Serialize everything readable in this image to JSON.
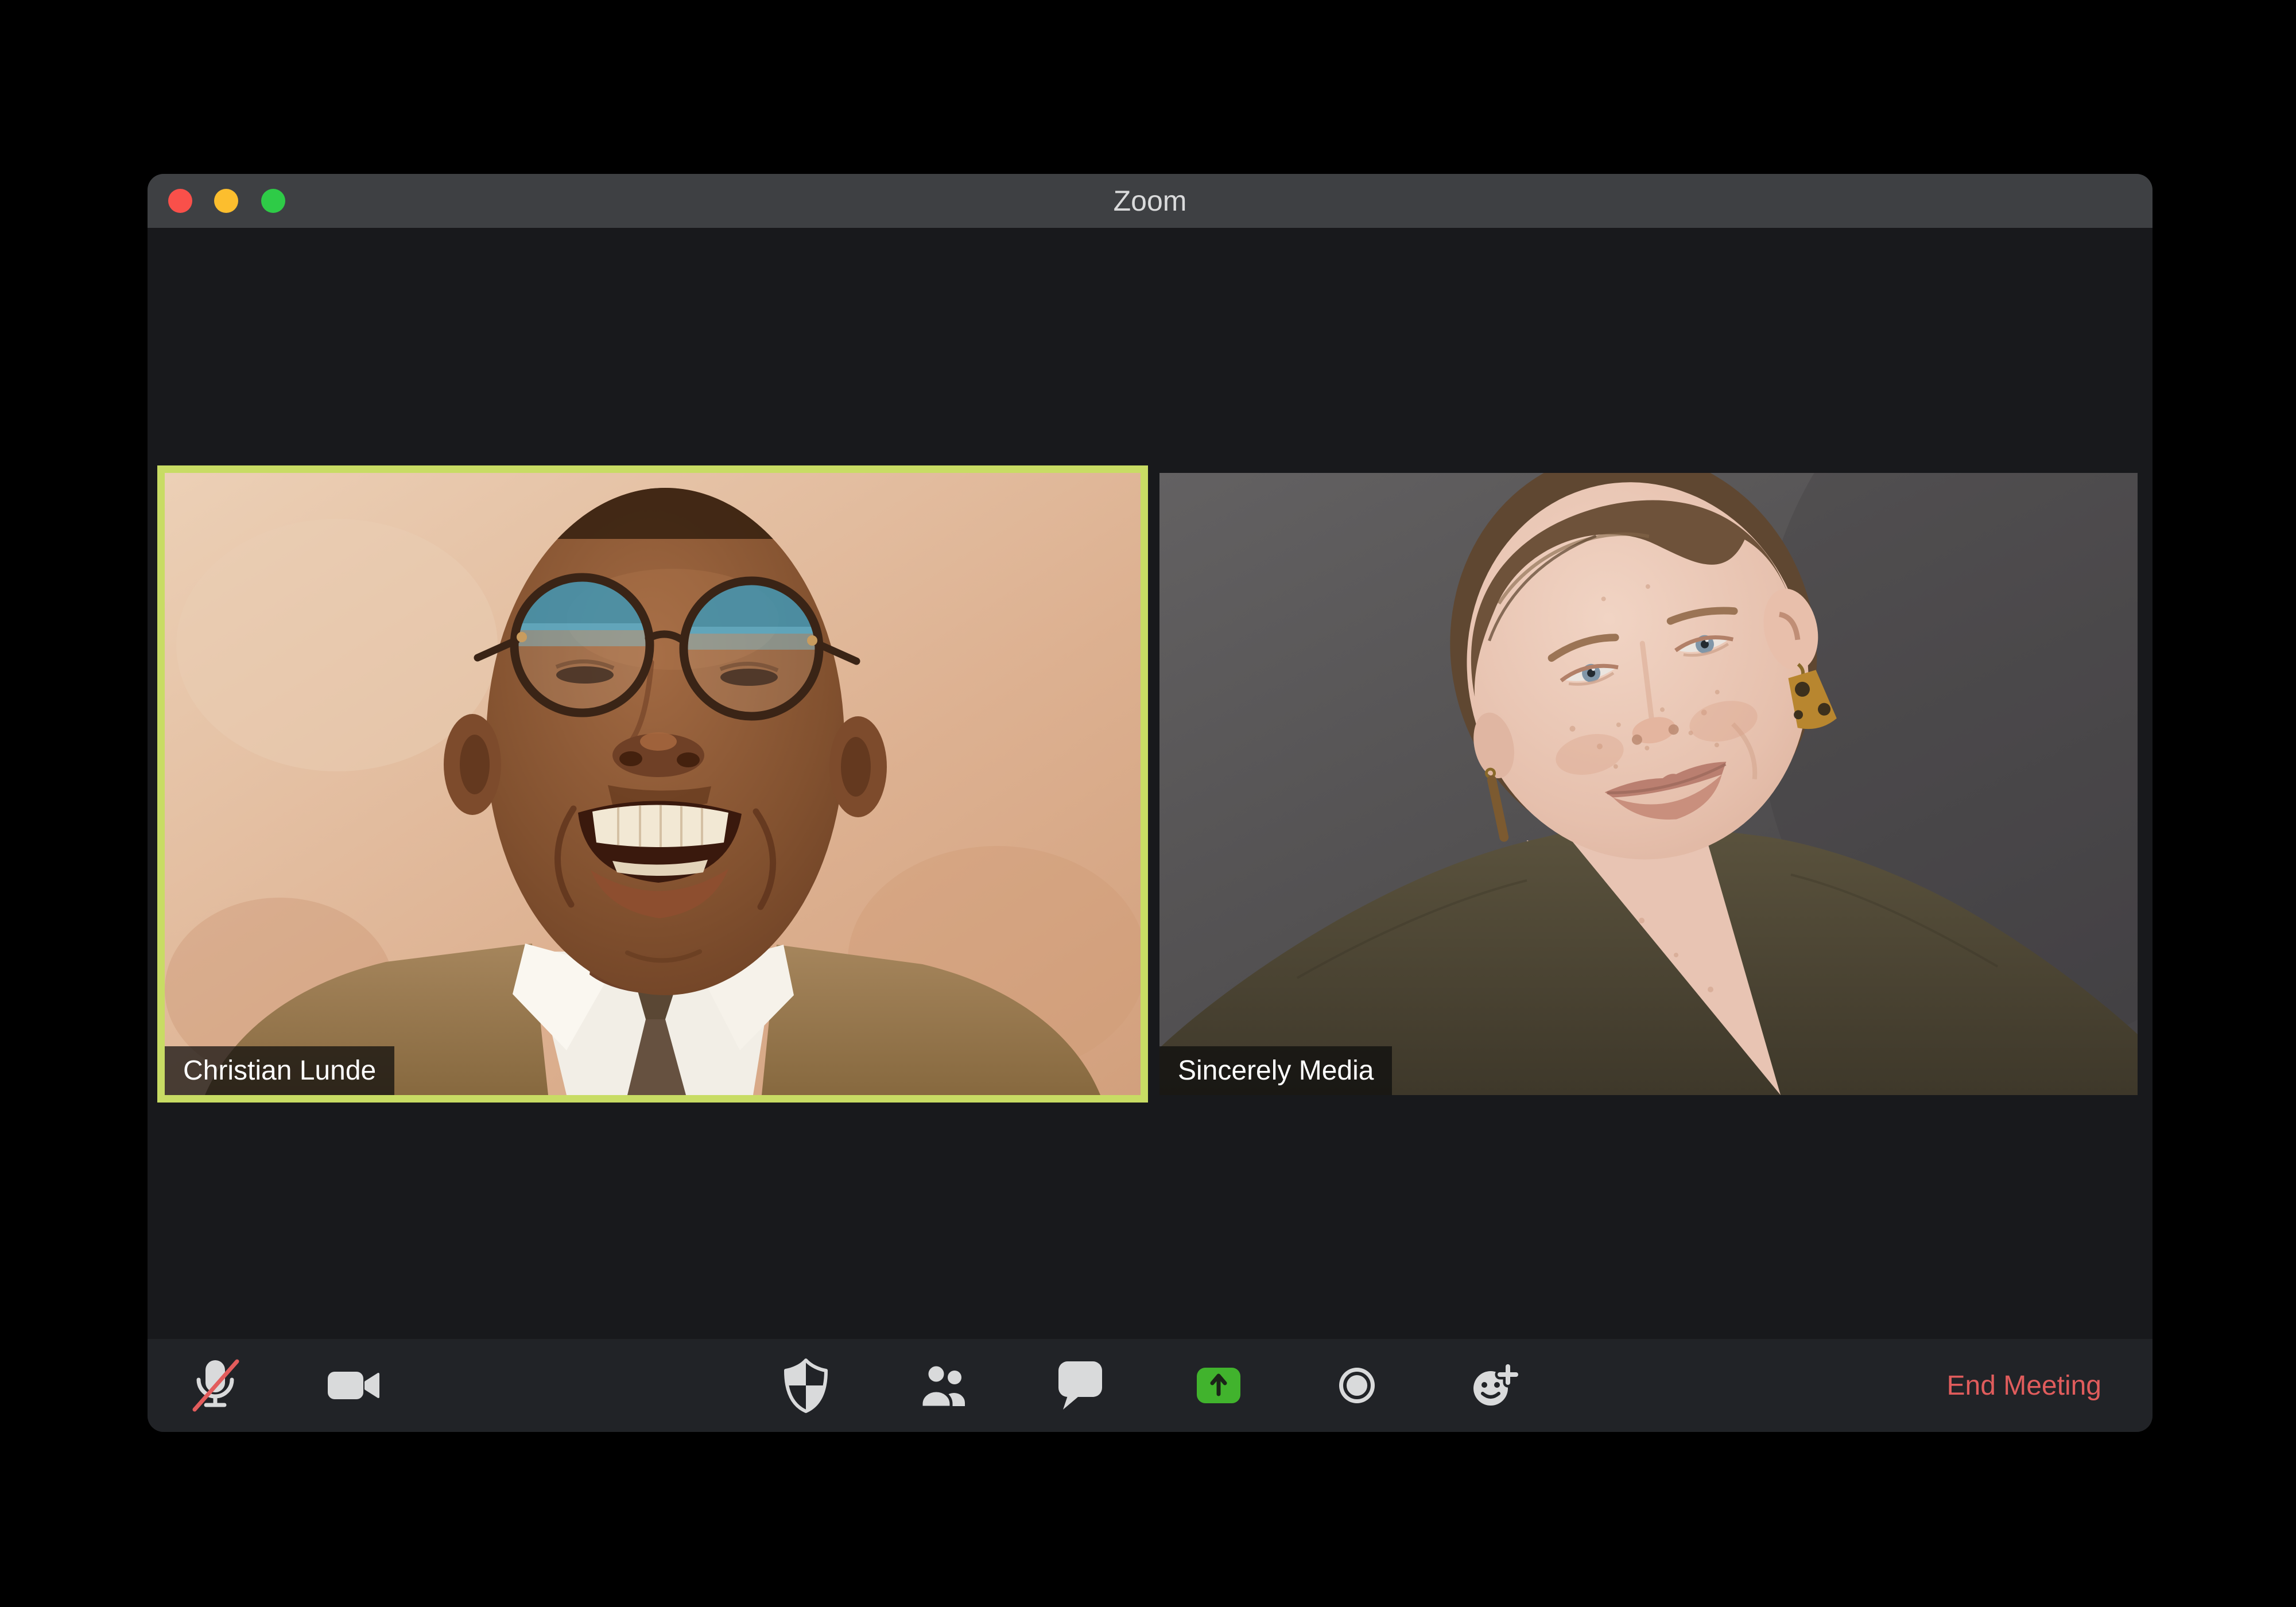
{
  "window": {
    "title": "Zoom",
    "traffic_lights": [
      {
        "id": "close",
        "color": "#f9504a"
      },
      {
        "id": "minimize",
        "color": "#fcbe2e"
      },
      {
        "id": "zoom",
        "color": "#2ecb47"
      }
    ]
  },
  "participants": [
    {
      "name": "Christian Lunde",
      "active_speaker": true
    },
    {
      "name": "Sincerely Media",
      "active_speaker": false
    }
  ],
  "toolbar": {
    "buttons": [
      {
        "id": "mute",
        "icon": "microphone-muted-icon",
        "state": "muted"
      },
      {
        "id": "video",
        "icon": "video-camera-icon"
      },
      {
        "id": "security",
        "icon": "security-shield-icon"
      },
      {
        "id": "participants",
        "icon": "participants-icon"
      },
      {
        "id": "chat",
        "icon": "chat-bubble-icon"
      },
      {
        "id": "share-screen",
        "icon": "share-screen-icon"
      },
      {
        "id": "record",
        "icon": "record-icon"
      },
      {
        "id": "reactions",
        "icon": "reactions-smiley-icon"
      }
    ],
    "end_meeting_label": "End Meeting"
  },
  "colors": {
    "active_speaker_border": "#c8dc64",
    "share_screen_green": "#41b32d",
    "end_meeting_red": "#e05c5c",
    "mute_slash_red": "#e25c5c",
    "titlebar": "#3e4043",
    "toolbar_background": "#212327",
    "window_background": "#18191c"
  }
}
